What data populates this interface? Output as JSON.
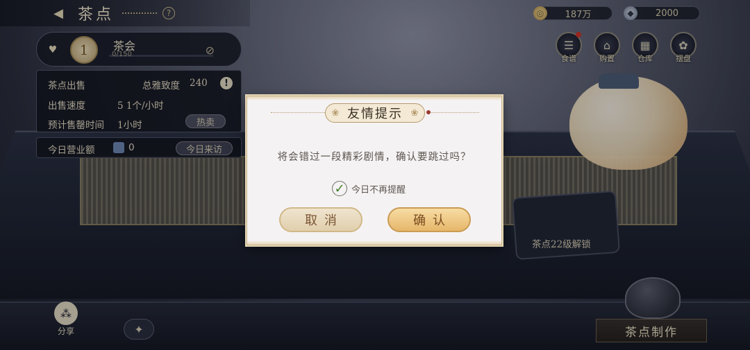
{
  "header": {
    "title": "茶点"
  },
  "currency": {
    "coins": "187万",
    "gems": "2000"
  },
  "menu": {
    "items": [
      {
        "label": "食谱",
        "icon": "recipe-icon",
        "has_dot": true
      },
      {
        "label": "购置",
        "icon": "purchase-icon",
        "has_dot": false
      },
      {
        "label": "仓库",
        "icon": "warehouse-icon",
        "has_dot": false
      },
      {
        "label": "摆盘",
        "icon": "plating-icon",
        "has_dot": false
      }
    ]
  },
  "level_card": {
    "level": "1",
    "name": "茶会",
    "progress": "0/150"
  },
  "stats": {
    "sale_label": "茶点出售",
    "total_label": "总雅致度",
    "total_value": "240",
    "speed_label": "出售速度",
    "speed_value": "5 1个/小时",
    "time_label": "预计售罄时间",
    "time_value": "1小时",
    "hot_sale_button": "热卖"
  },
  "revenue": {
    "label": "今日营业额",
    "value": "0",
    "visit_button": "今日来访"
  },
  "bottom": {
    "share_label": "分享",
    "unlock_label": "茶点22级解锁",
    "make_tea_button": "茶点制作"
  },
  "dialog": {
    "title": "友情提示",
    "message": "将会错过一段精彩剧情，确认要跳过吗？",
    "checkbox_label": "今日不再提醒",
    "checkbox_checked": true,
    "cancel_label": "取消",
    "confirm_label": "确认"
  }
}
